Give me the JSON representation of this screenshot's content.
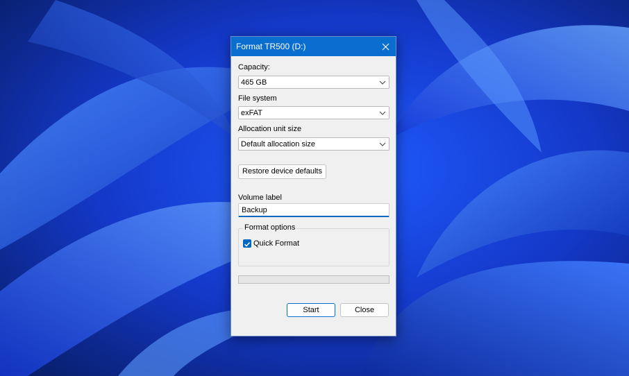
{
  "dialog": {
    "title": "Format TR500 (D:)",
    "capacity": {
      "label": "Capacity:",
      "value": "465 GB"
    },
    "file_system": {
      "label": "File system",
      "value": "exFAT"
    },
    "allocation": {
      "label": "Allocation unit size",
      "value": "Default allocation size"
    },
    "restore_label": "Restore device defaults",
    "volume": {
      "label": "Volume label",
      "value": "Backup"
    },
    "format_options": {
      "title": "Format options",
      "quick_format_label": "Quick Format",
      "quick_format_checked": true
    },
    "progress": 0,
    "start_label": "Start",
    "close_label": "Close"
  },
  "colors": {
    "titlebar": "#0a6ed1",
    "accent": "#0067c0",
    "dialog_bg": "#f0f0f0"
  }
}
